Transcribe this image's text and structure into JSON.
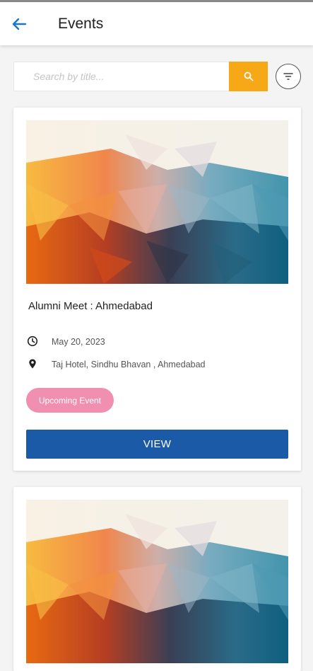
{
  "header": {
    "title": "Events",
    "back_icon": "arrow-left-icon",
    "accent_color": "#1976d2"
  },
  "search": {
    "placeholder": "Search by title...",
    "value": "",
    "button_icon": "search-icon",
    "button_color": "#f6a816",
    "filter_icon": "filter-icon"
  },
  "events": [
    {
      "title": "Alumni Meet : Ahmedabad",
      "date": "May 20, 2023",
      "location": "Taj Hotel, Sindhu Bhavan , Ahmedabad",
      "status": "Upcoming Event",
      "status_color": "#f08fb0",
      "button_label": "VIEW",
      "button_color": "#1a5aa6",
      "date_icon": "clock-icon",
      "location_icon": "map-pin-icon"
    }
  ]
}
